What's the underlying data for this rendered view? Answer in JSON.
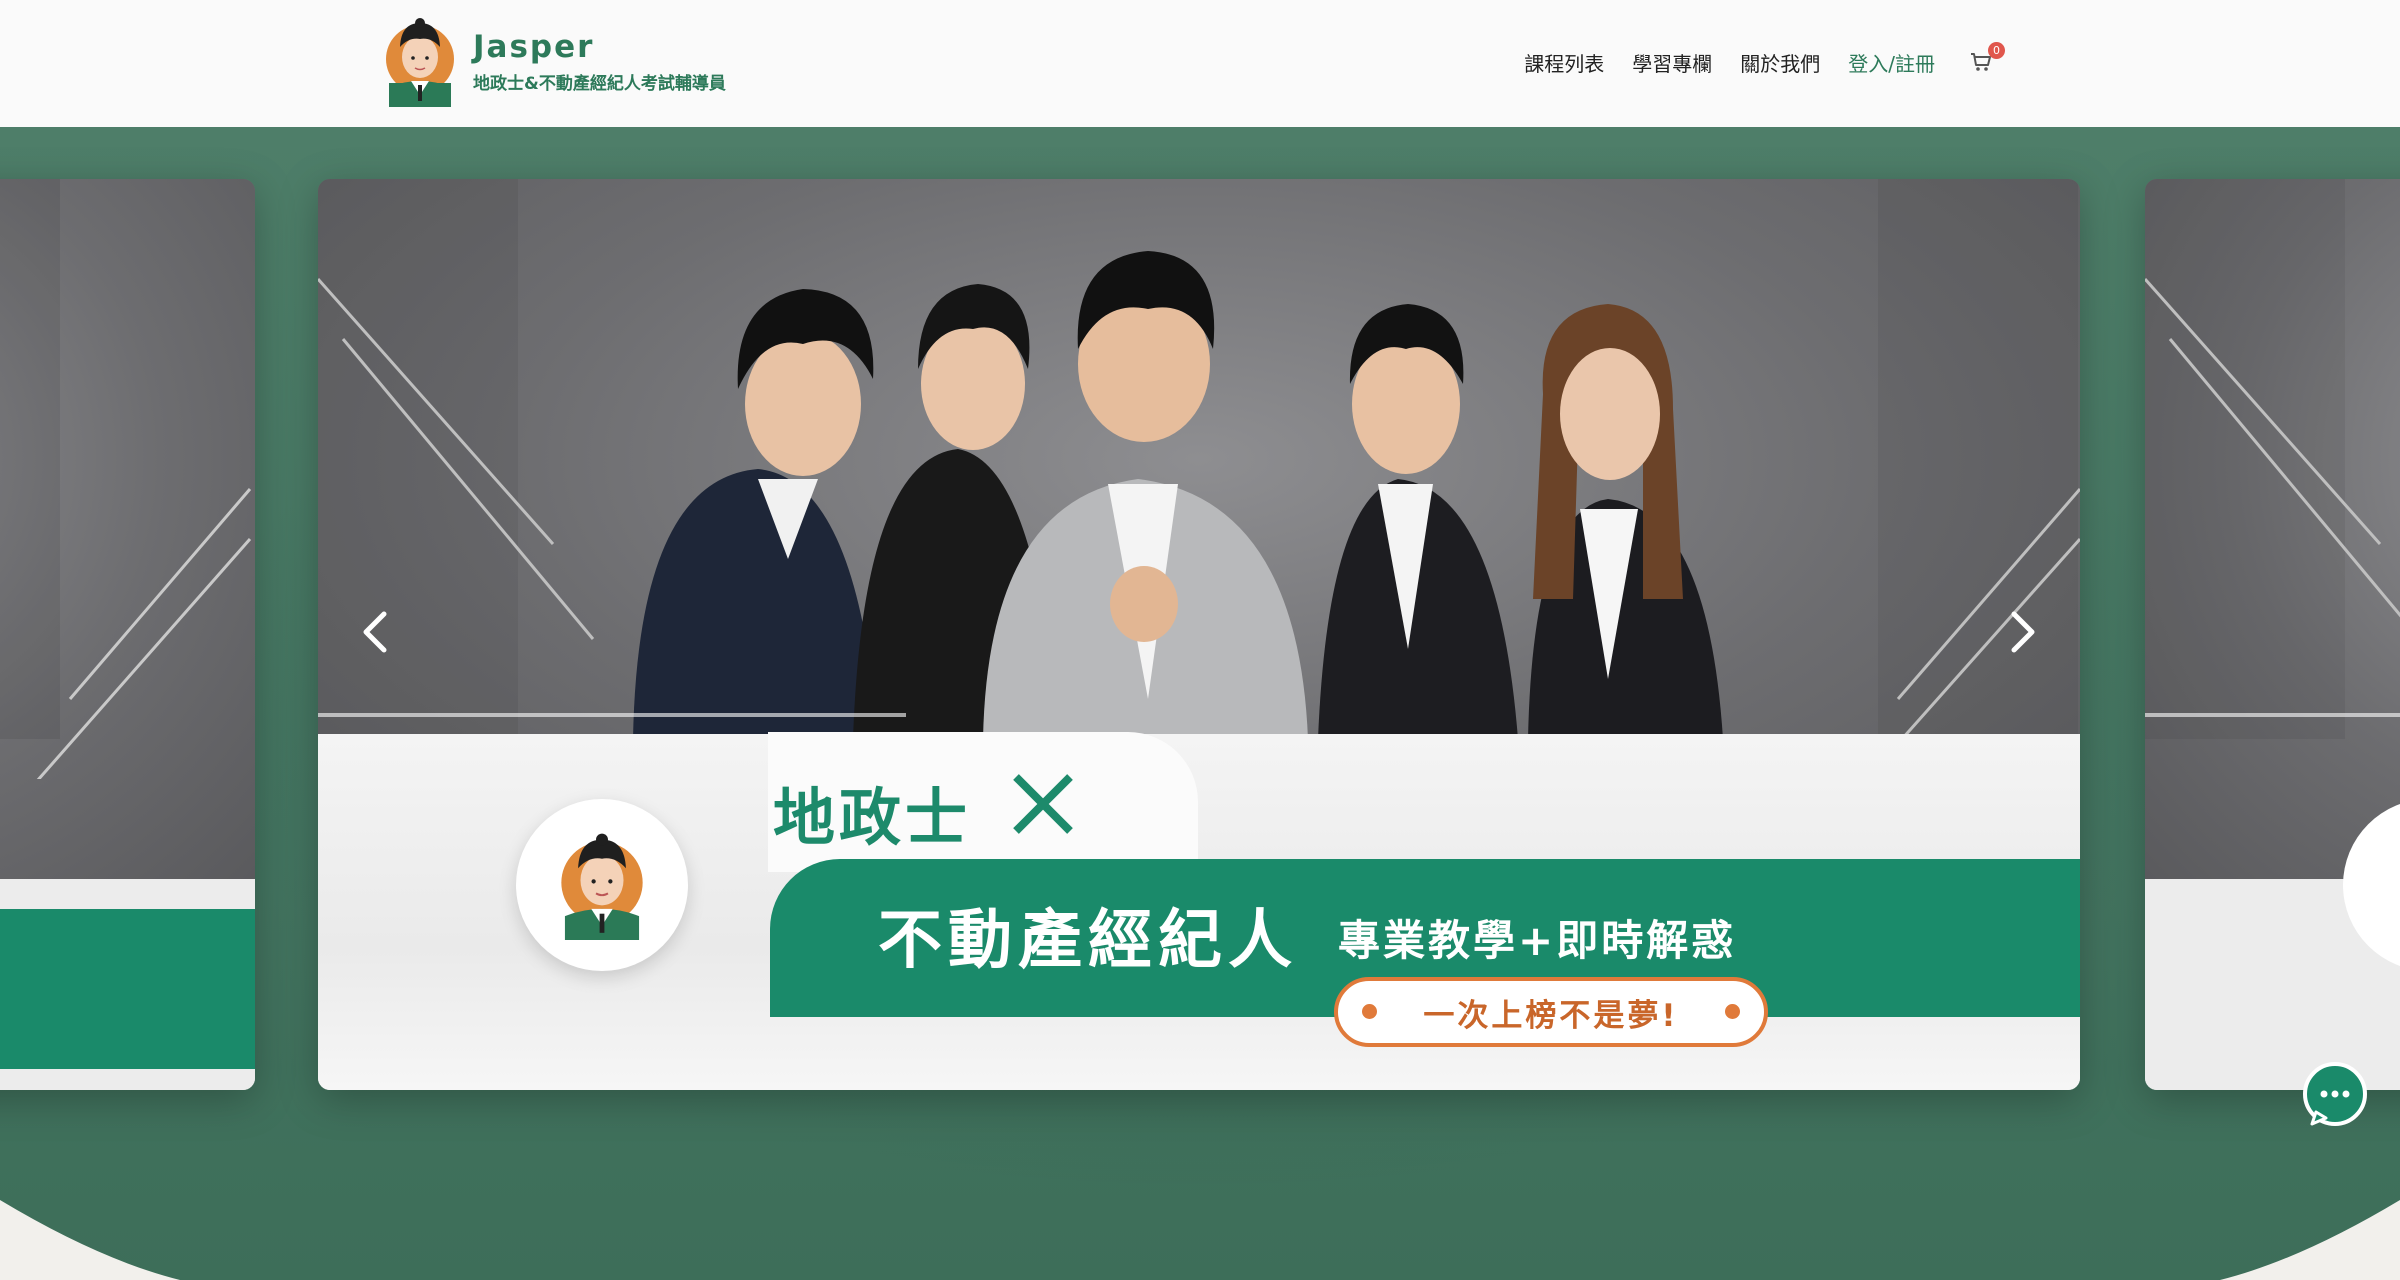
{
  "brand": {
    "name": "Jasper",
    "subtitle": "地政士&不動產經紀人考試輔導員"
  },
  "nav": {
    "items": [
      "課程列表",
      "學習專欄",
      "關於我們"
    ],
    "login": "登入/註冊",
    "cart_count": "0"
  },
  "hero": {
    "title_1": "地政士",
    "title_2": "不動產經紀人",
    "title_3": "專業教學+即時解惑",
    "cta": "一次上榜不是夢!"
  },
  "colors": {
    "brand_green": "#1a8a6a",
    "band_green": "#4b7c67",
    "accent_orange": "#e07a3a"
  },
  "icons": {
    "prev": "chevron-left-icon",
    "next": "chevron-right-icon",
    "cart": "cart-icon",
    "chat": "chat-bubble-icon"
  }
}
